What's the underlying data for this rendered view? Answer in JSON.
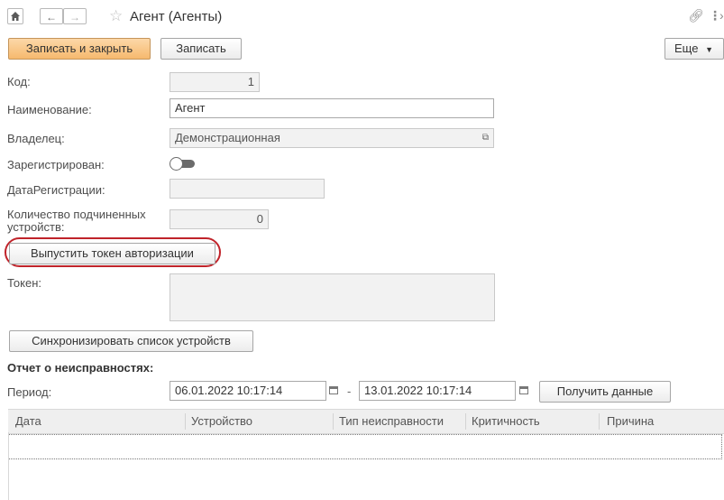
{
  "window": {
    "title": "Агент (Агенты)",
    "home_icon": "home-icon",
    "back_icon": "arrow-left-icon",
    "forward_icon": "arrow-right-icon",
    "star_icon": "star-icon",
    "link_icon": "link-icon",
    "more_icon": "vertical-dots-icon",
    "close_icon": "close-icon"
  },
  "toolbar": {
    "save_close_label": "Записать и закрыть",
    "save_label": "Записать",
    "more_label": "Еще",
    "accent_color": "#f6b96e"
  },
  "form": {
    "code_label": "Код:",
    "code_value": "1",
    "name_label": "Наименование:",
    "name_value": "Агент",
    "owner_label": "Владелец:",
    "owner_value": "Демонстрационная",
    "registered_label": "Зарегистрирован:",
    "registered_value": false,
    "regdate_label": "ДатаРегистрации:",
    "regdate_value": " .  .     :  :",
    "devices_label": "Количество подчиненных устройств:",
    "devices_value": "0",
    "issue_token_label": "Выпустить токен авторизации",
    "highlight_color": "#c0232a",
    "token_label": "Токен:",
    "token_value": "",
    "sync_label": "Синхронизировать список устройств"
  },
  "report": {
    "title": "Отчет о неисправностях:",
    "period_label": "Период:",
    "date_from": "06.01.2022 10:17:14",
    "dash": "-",
    "date_to": "13.01.2022 10:17:14",
    "get_data_label": "Получить данные",
    "columns": [
      "Дата",
      "Устройство",
      "Тип неисправности",
      "Критичность",
      "Причина"
    ],
    "rows": []
  }
}
